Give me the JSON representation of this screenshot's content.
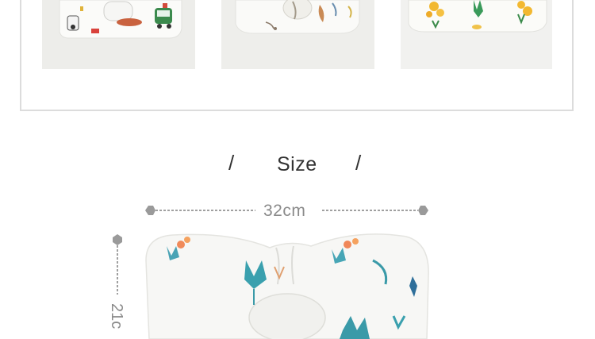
{
  "gallery": {
    "items": [
      {
        "name": "vehicles-print-pillow"
      },
      {
        "name": "feather-print-pillow"
      },
      {
        "name": "pineapple-print-pillow"
      }
    ]
  },
  "size_section": {
    "slash_left": "/",
    "title": "Size",
    "slash_right": "/",
    "width_label": "32cm",
    "height_label": "21c"
  },
  "colors": {
    "frame_border": "#dcdcdc",
    "ruler": "#9a9a9a",
    "label": "#8a8a8a",
    "heading": "#333333"
  }
}
